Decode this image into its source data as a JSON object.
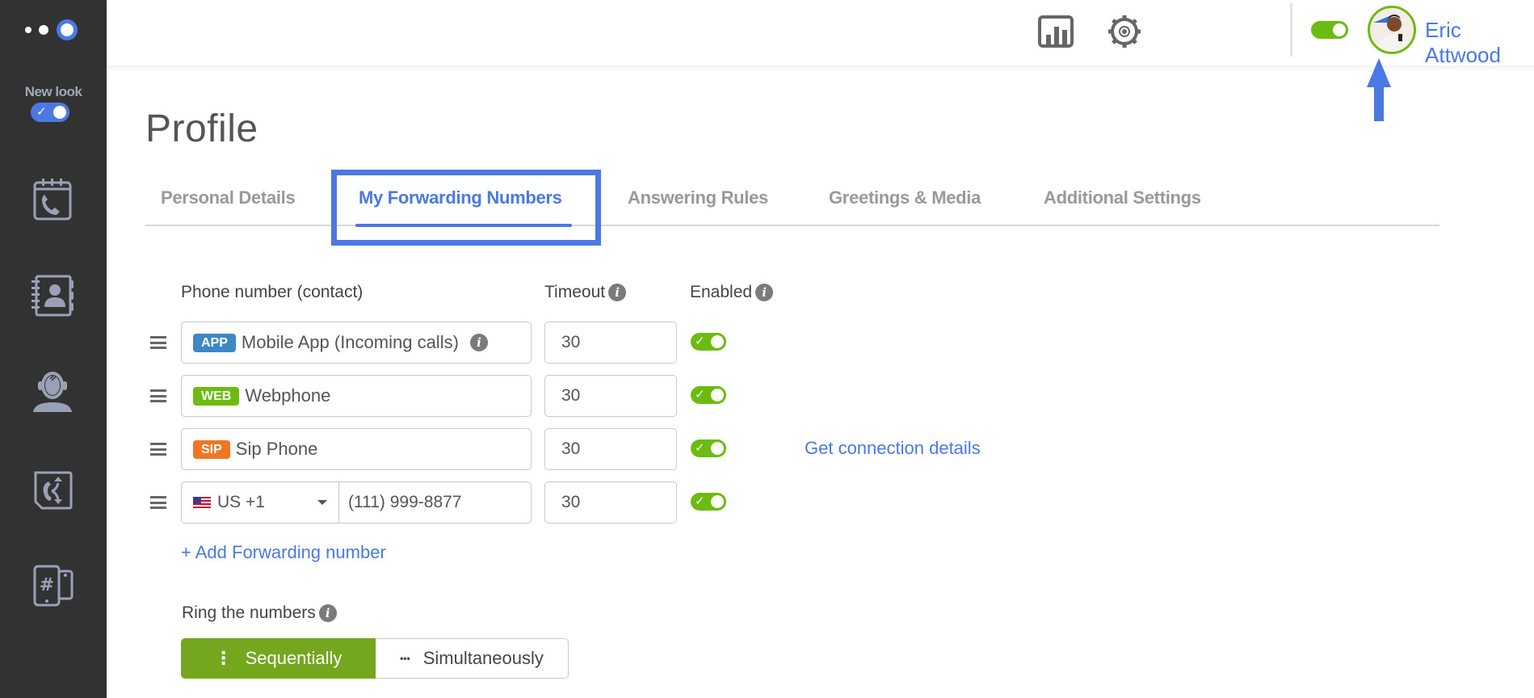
{
  "sidebar": {
    "logo_icon": "three-dots-logo-icon",
    "new_look": {
      "label": "New look",
      "enabled": true
    },
    "items": [
      {
        "name": "call-history",
        "icon": "calendar-phone-icon"
      },
      {
        "name": "contacts",
        "icon": "address-book-icon"
      },
      {
        "name": "call-center",
        "icon": "headset-agent-icon"
      },
      {
        "name": "call-routing",
        "icon": "call-flow-icon"
      },
      {
        "name": "phone-numbers",
        "icon": "hash-phones-icon"
      }
    ]
  },
  "header": {
    "icons": [
      "bar-chart-icon",
      "gear-icon"
    ],
    "status_enabled": true,
    "user_name": "Eric Attwood",
    "dialpad_icon": "phone-dialpad-icon"
  },
  "page": {
    "title": "Profile",
    "tabs": [
      {
        "label": "Personal Details",
        "active": false
      },
      {
        "label": "My Forwarding Numbers",
        "active": true
      },
      {
        "label": "Answering Rules",
        "active": false
      },
      {
        "label": "Greetings & Media",
        "active": false
      },
      {
        "label": "Additional Settings",
        "active": false
      }
    ]
  },
  "forwarding": {
    "columns": {
      "phone": "Phone number (contact)",
      "timeout": "Timeout",
      "enabled": "Enabled"
    },
    "rows": [
      {
        "badge": "APP",
        "badge_color": "#3d87c9",
        "label": "Mobile App (Incoming calls)",
        "has_info": true,
        "timeout": "30",
        "enabled": true
      },
      {
        "badge": "WEB",
        "badge_color": "#6cbb10",
        "label": "Webphone",
        "timeout": "30",
        "enabled": true
      },
      {
        "badge": "SIP",
        "badge_color": "#ef7622",
        "label": "Sip Phone",
        "timeout": "30",
        "enabled": true,
        "link": "Get connection details"
      },
      {
        "country": "US +1",
        "number": "(111) 999-8877",
        "timeout": "30",
        "enabled": true
      }
    ],
    "add_label": "+ Add Forwarding number"
  },
  "ring": {
    "label": "Ring the numbers",
    "options": [
      {
        "label": "Sequentially",
        "icon": "vertical-dots-icon",
        "glyph": "⋮",
        "selected": true
      },
      {
        "label": "Simultaneously",
        "icon": "horizontal-dots-icon",
        "glyph": "•••",
        "selected": false
      }
    ]
  },
  "colors": {
    "accent": "#4a79e4",
    "success": "#6cbb10",
    "selected_segment": "#74a71d",
    "sidebar_bg": "#323232"
  }
}
